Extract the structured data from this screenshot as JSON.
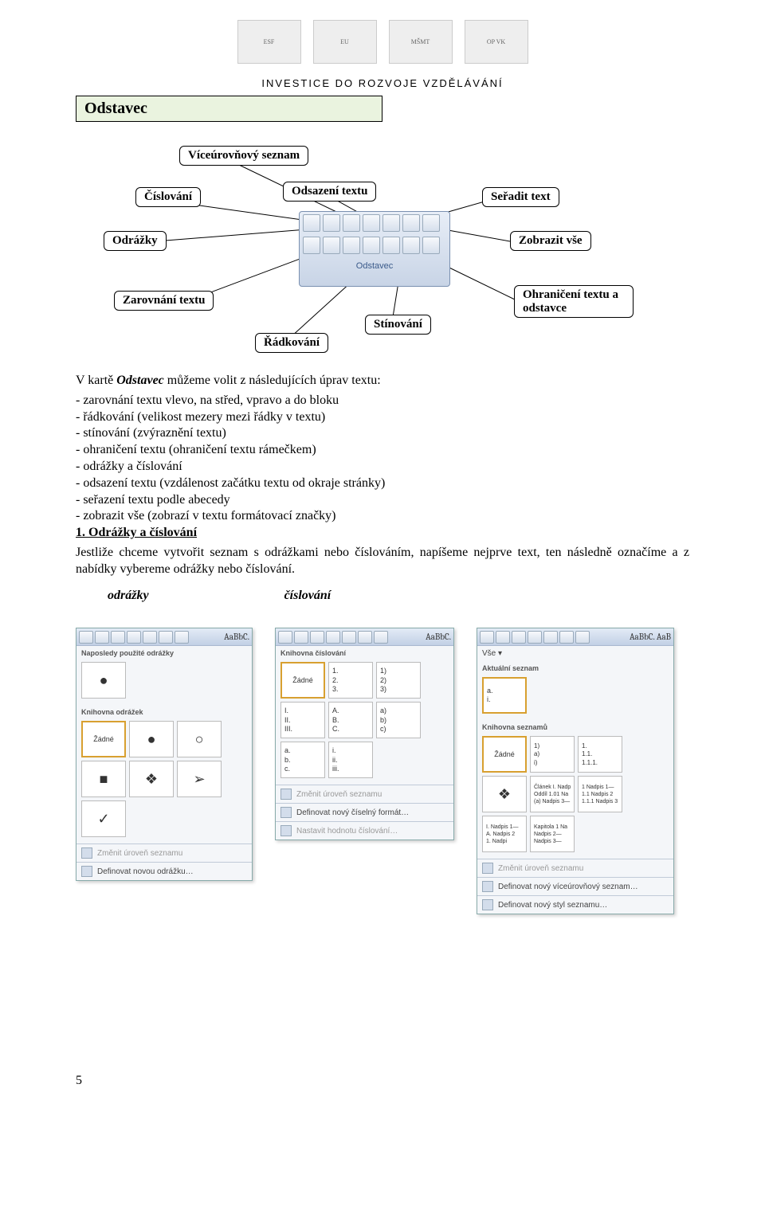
{
  "header": {
    "investice": "INVESTICE DO ROZVOJE VZDĚLÁVÁNÍ",
    "logos": [
      "ESF",
      "EU",
      "MŠMT",
      "OP VK"
    ]
  },
  "section_title": "Odstavec",
  "diagram": {
    "callouts": {
      "viceurovnovy": "Víceúrovňový seznam",
      "cislovani": "Číslování",
      "odsazeni": "Odsazení textu",
      "seradit": "Seřadit text",
      "odrazky": "Odrážky",
      "zobrazit": "Zobrazit vše",
      "zarovnani": "Zarovnání textu",
      "radkovani": "Řádkování",
      "stinovani": "Stínování",
      "ohraniceni": "Ohraničení textu a odstavce"
    },
    "panel_label": "Odstavec"
  },
  "content": {
    "intro_before": "V kartě ",
    "intro_bold": "Odstavec",
    "intro_after": " můžeme volit z následujících úprav textu:",
    "bullets": [
      "zarovnání textu vlevo, na střed, vpravo a do bloku",
      "řádkování (velikost mezery mezi řádky v textu)",
      "stínování (zvýraznění textu)",
      "ohraničení textu (ohraničení textu rámečkem)",
      "odrážky a číslování",
      "odsazení textu (vzdálenost začátku textu od okraje stránky)",
      "seřazení textu podle abecedy",
      "zobrazit vše (zobrazí v textu formátovací značky)"
    ],
    "sub1_title": "1. Odrážky a číslování",
    "sub1_text": "Jestliže chceme vytvořit seznam s odrážkami nebo číslováním, napíšeme nejprve text, ten následně označíme a z nabídky vybereme odrážky nebo číslování.",
    "label_odrazky": "odrážky",
    "label_cislovani": "číslování"
  },
  "dropdowns": {
    "bullets": {
      "ribbon_aa": "AaBbC.",
      "section1": "Naposledy použité odrážky",
      "section2": "Knihovna odrážek",
      "cells_lib": [
        "Žádné",
        "●",
        "○",
        "■",
        "❖",
        "➢",
        "✓"
      ],
      "footer1": "Změnit úroveň seznamu",
      "footer2": "Definovat novou odrážku…"
    },
    "numbers": {
      "ribbon_aa": "AaBbC.",
      "section1": "Knihovna číslování",
      "cells": [
        "Žádné",
        "1.\n2.\n3.",
        "1)\n2)\n3)",
        "I.\nII.\nIII.",
        "A.\nB.\nC.",
        "a)\nb)\nc)",
        "a.\nb.\nc.",
        "i.\nii.\niii."
      ],
      "footer1": "Změnit úroveň seznamu",
      "footer2": "Definovat nový číselný formát…",
      "footer3": "Nastavit hodnotu číslování…"
    },
    "multi": {
      "ribbon_aa": "AaBbC. AaB",
      "top": "Vše ▾",
      "section1": "Aktuální seznam",
      "cur": "a.\ni.",
      "section2": "Knihovna seznamů",
      "cells": [
        "Žádné",
        "1)\na)\ni)",
        "1.\n1.1.\n1.1.1.",
        "❖",
        "Článek I. Nadp\nOddíl 1.01 Na\n(a) Nadpis 3—",
        "1 Nadpis 1—\n1.1 Nadpis 2\n1.1.1 Nadpis 3",
        "I. Nadpis 1—\nA. Nadpis 2\n1. Nadpi",
        "Kapitola 1 Na\nNadpis 2—\nNadpis 3—"
      ],
      "footer1": "Změnit úroveň seznamu",
      "footer2": "Definovat nový víceúrovňový seznam…",
      "footer3": "Definovat nový styl seznamu…"
    }
  },
  "page_number": "5"
}
